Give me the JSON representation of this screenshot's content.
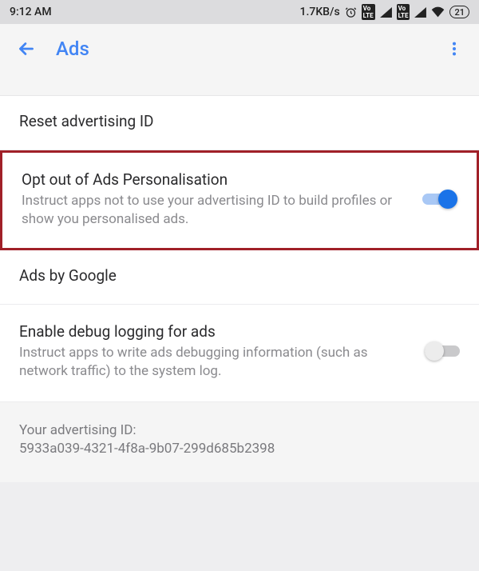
{
  "statusBar": {
    "time": "9:12 AM",
    "speed": "1.7KB/s",
    "battery": "21"
  },
  "appBar": {
    "title": "Ads"
  },
  "rows": {
    "reset": {
      "title": "Reset advertising ID"
    },
    "optOut": {
      "title": "Opt out of Ads Personalisation",
      "sub": "Instruct apps not to use your advertising ID to build profiles or show you personalised ads."
    },
    "adsBy": {
      "title": "Ads by Google"
    },
    "debug": {
      "title": "Enable debug logging for ads",
      "sub": "Instruct apps to write ads debugging information (such as network traffic) to the system log."
    },
    "adId": {
      "label": "Your advertising ID:",
      "value": "5933a039-4321-4f8a-9b07-299d685b2398"
    }
  }
}
